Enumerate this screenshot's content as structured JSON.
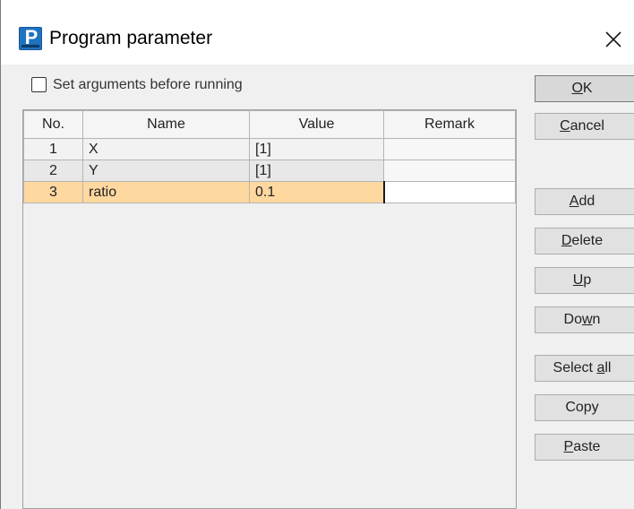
{
  "window": {
    "title": "Program parameter",
    "app_icon_letter": "P",
    "close_glyph": "✕"
  },
  "options": {
    "set_arguments_label": "Set arguments before running",
    "set_arguments_checked": false
  },
  "table": {
    "columns": [
      "No.",
      "Name",
      "Value",
      "Remark"
    ],
    "rows": [
      {
        "no": "1",
        "name": "X",
        "value": "[1]",
        "remark": ""
      },
      {
        "no": "2",
        "name": "Y",
        "value": "[1]",
        "remark": ""
      },
      {
        "no": "3",
        "name": "ratio",
        "value": "0.1",
        "remark": ""
      }
    ],
    "selected_row": 3
  },
  "buttons": {
    "ok": {
      "pre": "",
      "key": "O",
      "post": "K"
    },
    "cancel": {
      "pre": "",
      "key": "C",
      "post": "ancel"
    },
    "add": {
      "pre": "",
      "key": "A",
      "post": "dd"
    },
    "delete": {
      "pre": "",
      "key": "D",
      "post": "elete"
    },
    "up": {
      "pre": "",
      "key": "U",
      "post": "p"
    },
    "down": {
      "pre": "Do",
      "key": "w",
      "post": "n"
    },
    "select_all": {
      "pre": "Select ",
      "key": "a",
      "post": "ll"
    },
    "copy": {
      "pre": "Copy",
      "key": "",
      "post": ""
    },
    "paste": {
      "pre": "",
      "key": "P",
      "post": "aste"
    }
  },
  "colors": {
    "selected_row": "#ffd8a0",
    "app_icon": "#1e73be"
  }
}
